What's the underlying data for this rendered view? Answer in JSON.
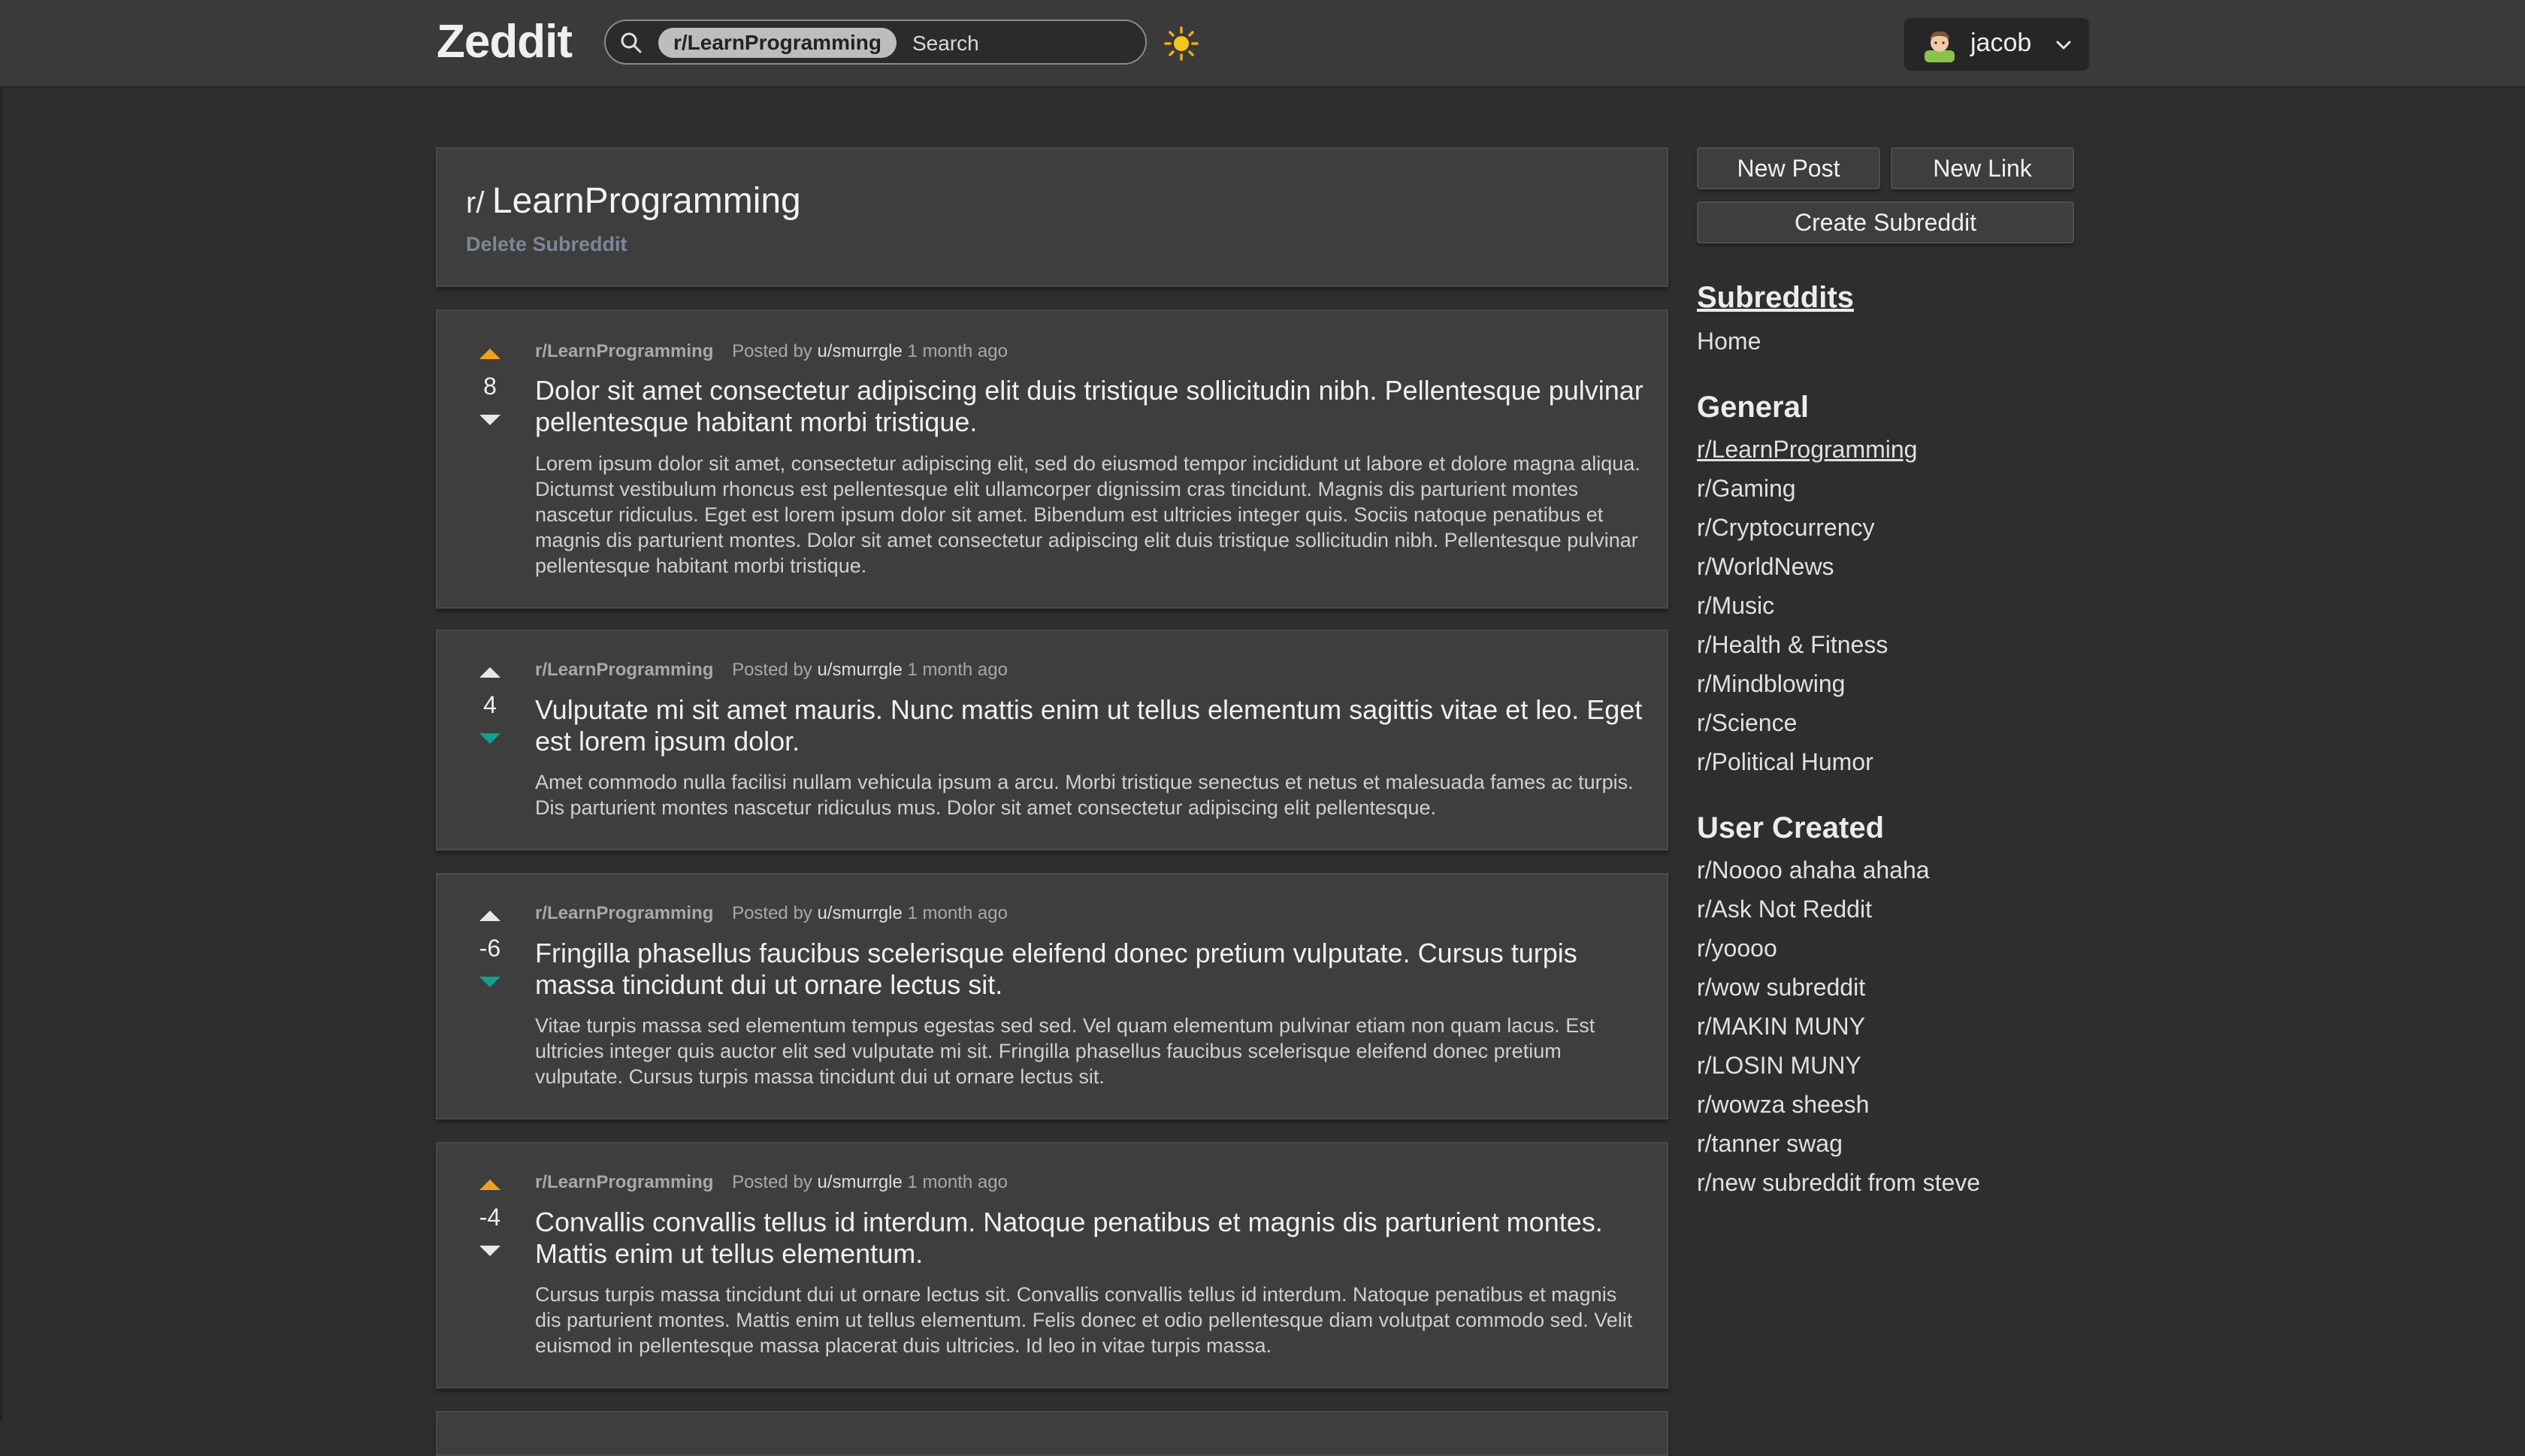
{
  "header": {
    "logo": "Zeddit",
    "search_chip": "r/LearnProgramming",
    "search_placeholder": "Search",
    "username": "jacob"
  },
  "subreddit": {
    "prefix": "r/",
    "name": "LearnProgramming",
    "delete_label": "Delete Subreddit"
  },
  "posts": [
    {
      "subreddit": "r/LearnProgramming",
      "posted_by": "Posted by",
      "user": "u/smurrgle",
      "time": "1 month ago",
      "score": "8",
      "vote": "up",
      "title": "Dolor sit amet consectetur adipiscing elit duis tristique sollicitudin nibh. Pellentesque pulvinar pellentesque habitant morbi tristique.",
      "body": "Lorem ipsum dolor sit amet, consectetur adipiscing elit, sed do eiusmod tempor incididunt ut labore et dolore magna aliqua. Dictumst vestibulum rhoncus est pellentesque elit ullamcorper dignissim cras tincidunt. Magnis dis parturient montes nascetur ridiculus. Eget est lorem ipsum dolor sit amet. Bibendum est ultricies integer quis. Sociis natoque penatibus et magnis dis parturient montes. Dolor sit amet consectetur adipiscing elit duis tristique sollicitudin nibh. Pellentesque pulvinar pellentesque habitant morbi tristique."
    },
    {
      "subreddit": "r/LearnProgramming",
      "posted_by": "Posted by",
      "user": "u/smurrgle",
      "time": "1 month ago",
      "score": "4",
      "vote": "down",
      "title": "Vulputate mi sit amet mauris. Nunc mattis enim ut tellus elementum sagittis vitae et leo. Eget est lorem ipsum dolor.",
      "body": "Amet commodo nulla facilisi nullam vehicula ipsum a arcu. Morbi tristique senectus et netus et malesuada fames ac turpis. Dis parturient montes nascetur ridiculus mus. Dolor sit amet consectetur adipiscing elit pellentesque."
    },
    {
      "subreddit": "r/LearnProgramming",
      "posted_by": "Posted by",
      "user": "u/smurrgle",
      "time": "1 month ago",
      "score": "-6",
      "vote": "down",
      "title": "Fringilla phasellus faucibus scelerisque eleifend donec pretium vulputate. Cursus turpis massa tincidunt dui ut ornare lectus sit.",
      "body": "Vitae turpis massa sed elementum tempus egestas sed sed. Vel quam elementum pulvinar etiam non quam lacus. Est ultricies integer quis auctor elit sed vulputate mi sit. Fringilla phasellus faucibus scelerisque eleifend donec pretium vulputate. Cursus turpis massa tincidunt dui ut ornare lectus sit."
    },
    {
      "subreddit": "r/LearnProgramming",
      "posted_by": "Posted by",
      "user": "u/smurrgle",
      "time": "1 month ago",
      "score": "-4",
      "vote": "up",
      "title": "Convallis convallis tellus id interdum. Natoque penatibus et magnis dis parturient montes. Mattis enim ut tellus elementum.",
      "body": "Cursus turpis massa tincidunt dui ut ornare lectus sit. Convallis convallis tellus id interdum. Natoque penatibus et magnis dis parturient montes. Mattis enim ut tellus elementum. Felis donec et odio pellentesque diam volutpat commodo sed. Velit euismod in pellentesque massa placerat duis ultricies. Id leo in vitae turpis massa."
    }
  ],
  "sidebar": {
    "new_post": "New Post",
    "new_link": "New Link",
    "create_subreddit": "Create Subreddit",
    "subreddits_heading": "Subreddits",
    "home": "Home",
    "general_heading": "General",
    "general": [
      "r/LearnProgramming",
      "r/Gaming",
      "r/Cryptocurrency",
      "r/WorldNews",
      "r/Music",
      "r/Health & Fitness",
      "r/Mindblowing",
      "r/Science",
      "r/Political Humor"
    ],
    "user_created_heading": "User Created",
    "user_created": [
      "r/Noooo ahaha ahaha",
      "r/Ask Not Reddit",
      "r/yoooo",
      "r/wow subreddit",
      "r/MAKIN MUNY",
      "r/LOSIN MUNY",
      "r/wowza sheesh",
      "r/tanner swag",
      "r/new subreddit from steve"
    ]
  },
  "colors": {
    "upvote_active": "#f0a020",
    "downvote_active": "#14a090",
    "arrow_inactive": "#e8e8e8",
    "sun": "#f5c518"
  }
}
